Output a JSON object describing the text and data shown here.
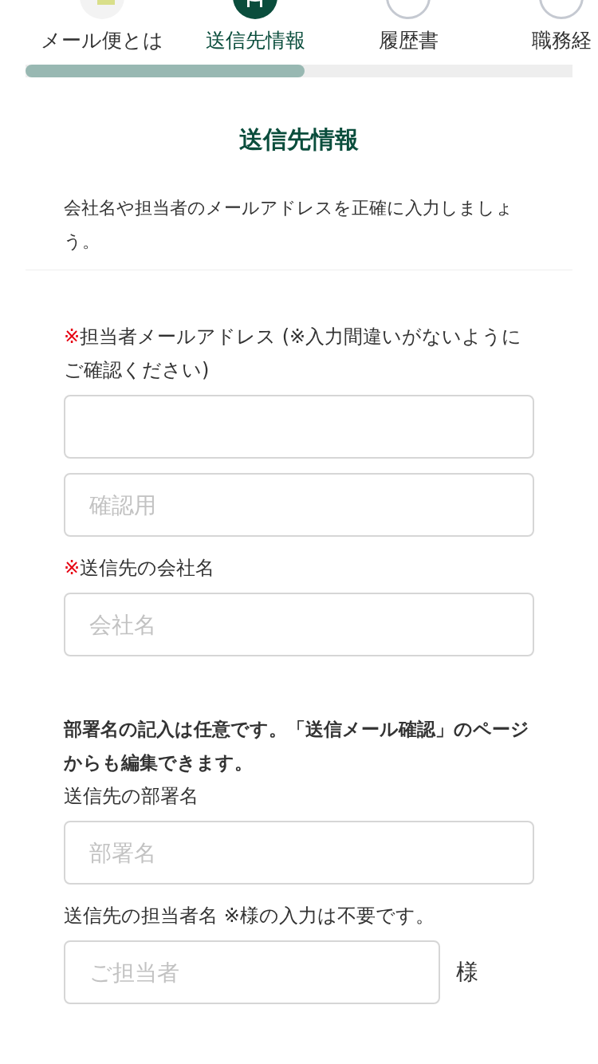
{
  "steps": [
    {
      "label": "メール便とは",
      "selected": false,
      "kind": "intro"
    },
    {
      "label": "送信先情報",
      "selected": true,
      "kind": "current"
    },
    {
      "label": "履歴書",
      "selected": false,
      "kind": "numbered"
    },
    {
      "label": "職務経",
      "selected": false,
      "kind": "numbered"
    }
  ],
  "progress": {
    "level": 0.51
  },
  "title": "送信先情報",
  "intro": "会社名や担当者のメールアドレスを正確に入力しましょう。",
  "form": [
    {
      "kind": "label",
      "required_mark": "※",
      "text": "担当者メールアドレス (※入力間違いがないようにご確認ください)"
    },
    {
      "kind": "input"
    },
    {
      "kind": "input",
      "placeholder": "確認用"
    },
    {
      "kind": "label",
      "required_mark": "※",
      "text": "送信先の会社名"
    },
    {
      "kind": "input",
      "placeholder": "会社名"
    },
    {
      "kind": "note",
      "text": "部署名の記入は任意です。「送信メール確認」のページからも編集できます。"
    },
    {
      "kind": "label",
      "text": "送信先の部署名"
    },
    {
      "kind": "input",
      "placeholder": "部署名"
    },
    {
      "kind": "label",
      "text": "送信先の担当者名 ※様の入力は不要です。"
    },
    {
      "kind": "input",
      "placeholder": "ご担当者",
      "suffix": "様"
    }
  ]
}
